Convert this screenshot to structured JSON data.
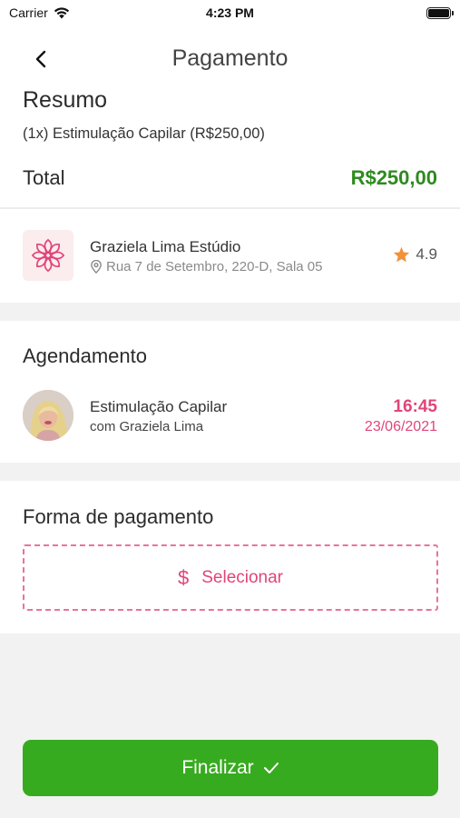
{
  "status_bar": {
    "carrier": "Carrier",
    "time": "4:23 PM"
  },
  "nav": {
    "title": "Pagamento",
    "back_icon": "chevron-left-icon"
  },
  "summary": {
    "heading": "Resumo",
    "item": "(1x) Estimulação Capilar (R$250,00)",
    "total_label": "Total",
    "total_value": "R$250,00"
  },
  "salon": {
    "name": "Graziela Lima Estúdio",
    "address": "Rua 7 de Setembro, 220-D, Sala 05",
    "rating": "4.9",
    "logo_icon": "flower-logo-icon"
  },
  "appointment": {
    "heading": "Agendamento",
    "service": "Estimulação Capilar",
    "professional": "com Graziela Lima",
    "time": "16:45",
    "date": "23/06/2021"
  },
  "payment": {
    "heading": "Forma de pagamento",
    "select_label": "Selecionar"
  },
  "footer": {
    "finalize_label": "Finalizar"
  },
  "colors": {
    "accent_pink": "#e0457a",
    "total_green": "#2e8b1f",
    "button_green": "#37ab1f",
    "star_orange": "#f0923a"
  }
}
